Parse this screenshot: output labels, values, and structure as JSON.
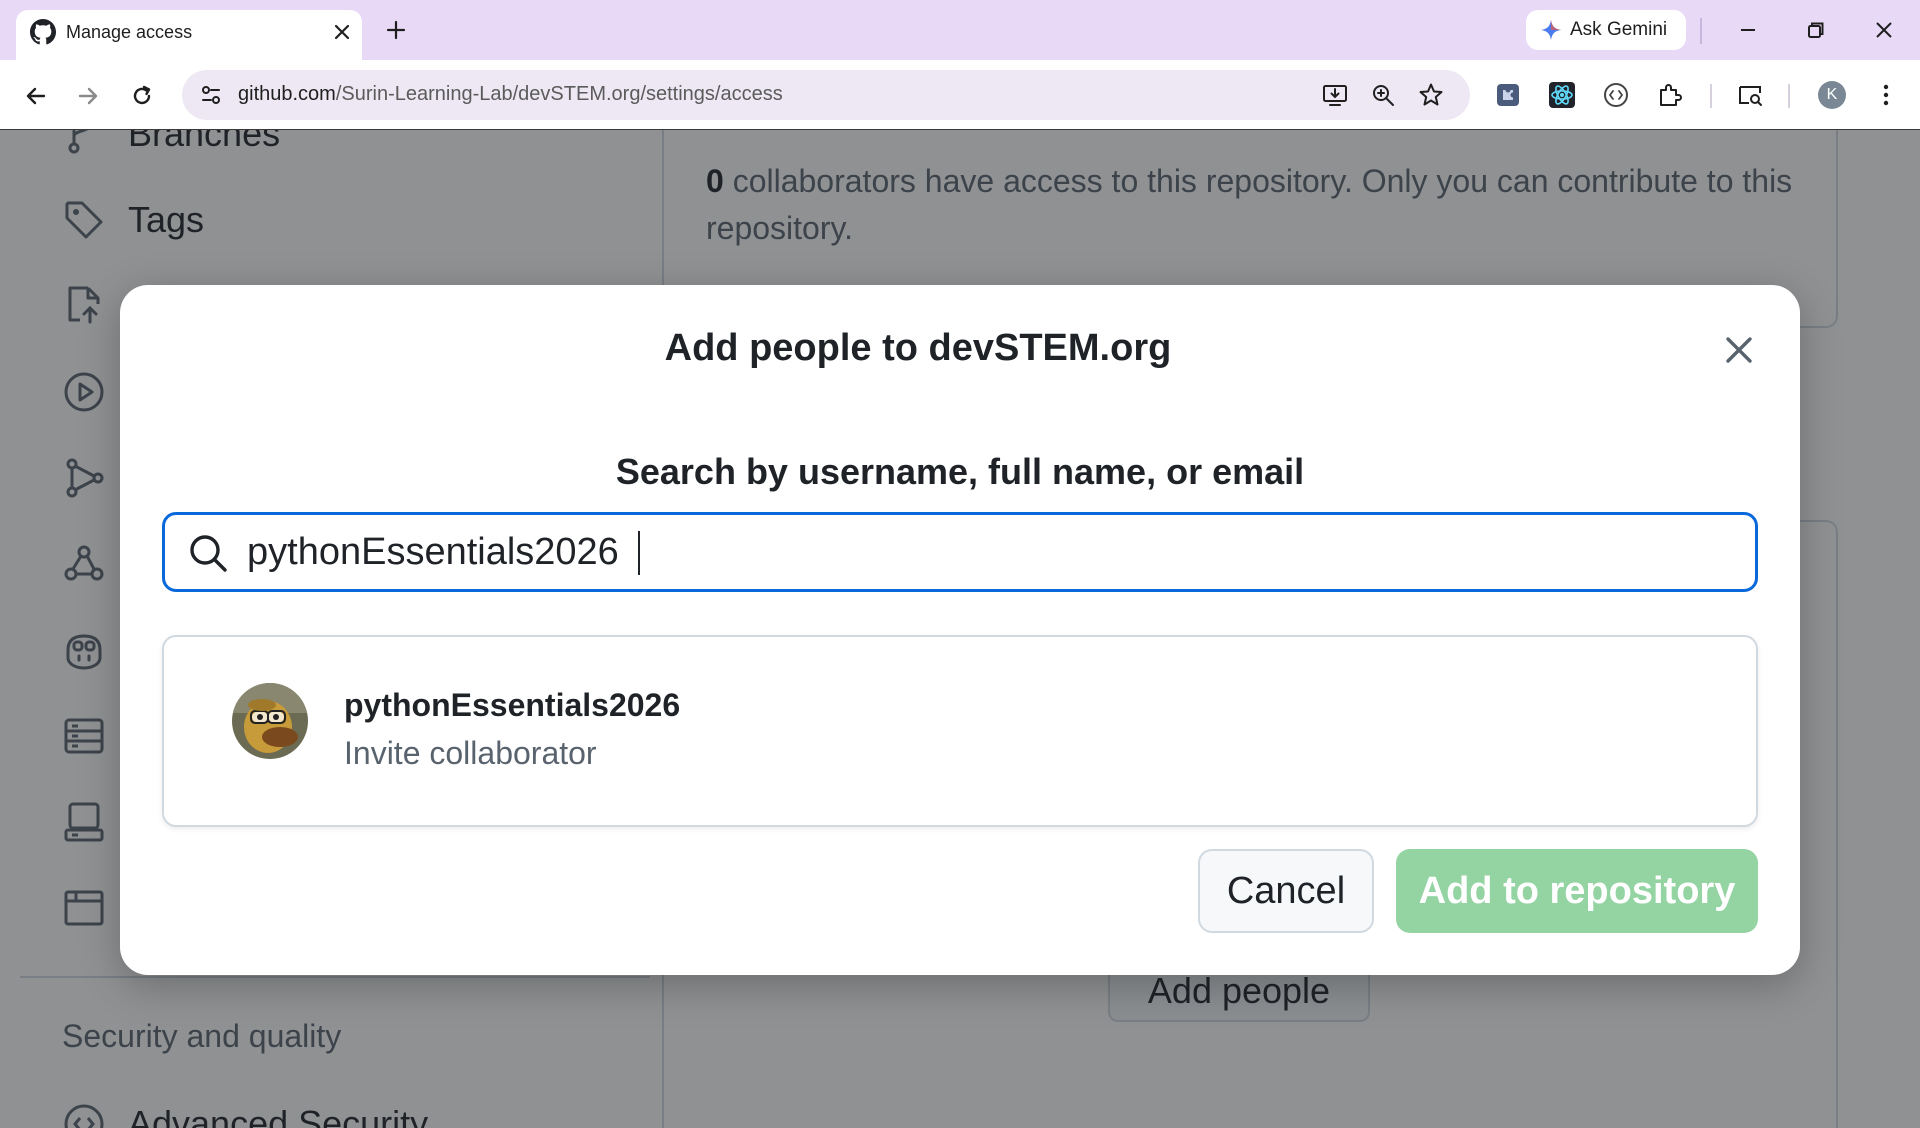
{
  "browser": {
    "tab_title": "Manage access",
    "gemini_label": "Ask Gemini",
    "url_host": "github.com",
    "url_path": "/Surin-Learning-Lab/devSTEM.org/settings/access",
    "profile_initial": "K"
  },
  "sidebar": {
    "items": [
      {
        "label": "Branches",
        "icon": "branch-icon"
      },
      {
        "label": "Tags",
        "icon": "tag-icon"
      },
      {
        "label": "",
        "icon": "push-rules-icon"
      },
      {
        "label": "",
        "icon": "actions-play-icon"
      },
      {
        "label": "",
        "icon": "workflow-graph-icon"
      },
      {
        "label": "",
        "icon": "webhook-icon"
      },
      {
        "label": "",
        "icon": "copilot-icon"
      },
      {
        "label": "",
        "icon": "environments-icon"
      },
      {
        "label": "",
        "icon": "codespaces-icon"
      },
      {
        "label": "",
        "icon": "pages-browser-icon"
      }
    ],
    "section_security": "Security and quality",
    "advanced_security": "Advanced Security"
  },
  "background": {
    "collab_count": "0",
    "collab_text": "collaborators have access to this repository. Only you can contribute to this repository.",
    "add_people_label": "Add people"
  },
  "modal": {
    "title": "Add people to devSTEM.org",
    "search_label": "Search by username, full name, or email",
    "search_value": "pythonEssentials2026",
    "result": {
      "username": "pythonEssentials2026",
      "action": "Invite collaborator"
    },
    "cancel_label": "Cancel",
    "add_label": "Add to repository"
  },
  "colors": {
    "tab_strip": "#e8d9f7",
    "focus_border": "#0969da",
    "primary_disabled": "#94d3a2"
  }
}
